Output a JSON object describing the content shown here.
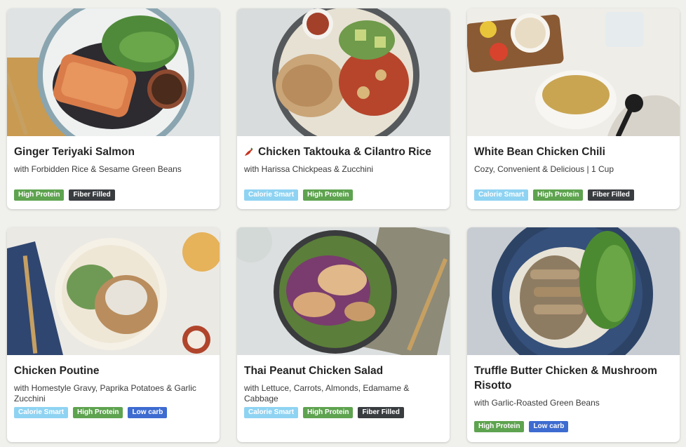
{
  "meals": [
    {
      "title": "Ginger Teriyaki Salmon",
      "subtitle": "with Forbidden Rice & Sesame Green Beans",
      "spicy": false,
      "tags": [
        "High Protein",
        "Fiber Filled"
      ]
    },
    {
      "title": "Chicken Taktouka & Cilantro Rice",
      "subtitle": "with Harissa Chickpeas & Zucchini",
      "spicy": true,
      "tags": [
        "Calorie Smart",
        "High Protein"
      ]
    },
    {
      "title": "White Bean Chicken Chili",
      "subtitle": "Cozy, Convenient & Delicious | 1 Cup",
      "spicy": false,
      "tags": [
        "Calorie Smart",
        "High Protein",
        "Fiber Filled"
      ]
    },
    {
      "title": "Chicken Poutine",
      "subtitle": "with Homestyle Gravy, Paprika Potatoes & Garlic Zucchini",
      "spicy": false,
      "tags": [
        "Calorie Smart",
        "High Protein",
        "Low carb"
      ]
    },
    {
      "title": "Thai Peanut Chicken Salad",
      "subtitle": "with Lettuce, Carrots, Almonds, Edamame & Cabbage",
      "spicy": false,
      "tags": [
        "Calorie Smart",
        "High Protein",
        "Fiber Filled"
      ]
    },
    {
      "title": "Truffle Butter Chicken & Mushroom Risotto",
      "subtitle": "with Garlic-Roasted Green Beans",
      "spicy": false,
      "tags": [
        "High Protein",
        "Low carb"
      ]
    }
  ],
  "tag_colors": {
    "Calorie Smart": "#8fd3f2",
    "High Protein": "#5ea34f",
    "Fiber Filled": "#3a3d40",
    "Low carb": "#3d6bd0"
  },
  "icons": {
    "spicy": "chili-pepper-icon"
  }
}
